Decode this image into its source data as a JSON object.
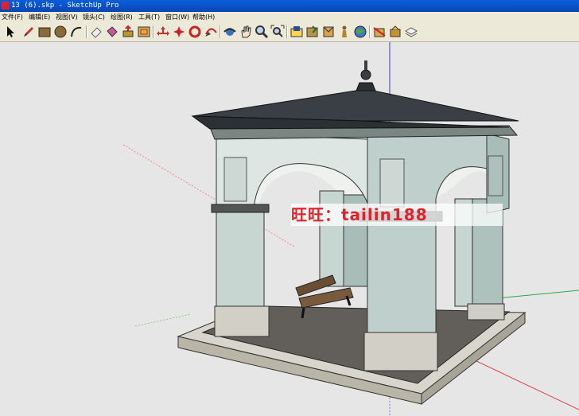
{
  "window": {
    "title": "13 (6).skp - SketchUp Pro"
  },
  "menu": [
    {
      "label": "文件(F)"
    },
    {
      "label": "编辑(E)"
    },
    {
      "label": "视图(V)"
    },
    {
      "label": "镜头(C)"
    },
    {
      "label": "绘图(R)"
    },
    {
      "label": "工具(T)"
    },
    {
      "label": "窗口(W)"
    },
    {
      "label": "帮助(H)"
    }
  ],
  "toolbar": [
    "select-tool",
    "pencil-line-tool",
    "rectangle-tool",
    "circle-tool",
    "arc-tool",
    "eraser-tool",
    "paint-bucket-tool",
    "push-pull-tool",
    "offset-tool",
    "move-tool",
    "rotate-tool",
    "follow-me-tool",
    "scale-tool",
    "orbit-tool",
    "pan-tool",
    "zoom-tool",
    "zoom-extents-tool",
    "warehouse-tool",
    "share-model-tool",
    "component-tool",
    "extension-tool",
    "section-tool",
    "style-tool",
    "layer-tool"
  ],
  "watermark": {
    "text": "旺旺：tailin188"
  },
  "colors": {
    "titlebar": "#0b4fc4",
    "menubar": "#ece9d8",
    "viewport": "#e6e6e6",
    "watermark": "#e0232b"
  }
}
